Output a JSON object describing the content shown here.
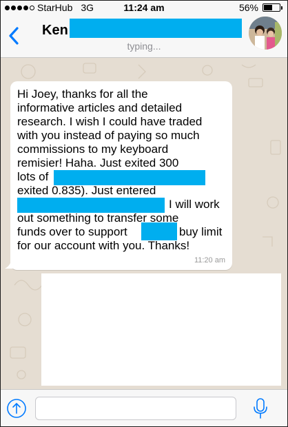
{
  "status_bar": {
    "carrier": "StarHub",
    "network": "3G",
    "time": "11:24 am",
    "battery": "56%",
    "battery_level": 0.56
  },
  "header": {
    "back_icon": "chevron-left-icon",
    "contact_name": "Ken",
    "status": "typing..."
  },
  "message": {
    "lines": [
      "Hi Joey, thanks for all the",
      "informative articles and detailed",
      "research.  I wish I could have traded",
      "with you instead of paying so much",
      "commissions to my keyboard",
      "remisier!  Haha.  Just exited 300",
      "lots of",
      "exited 0.835).   Just entered",
      "I will work",
      "out something to transfer some",
      "funds over to support",
      "buy limit",
      "for our account with you.  Thanks!"
    ],
    "time": "11:20 am"
  },
  "input_bar": {
    "upload_icon": "arrow-up-circle-icon",
    "placeholder": "",
    "mic_icon": "microphone-icon"
  },
  "colors": {
    "accent": "#007aff",
    "redaction": "#00aeef",
    "chat_background": "#e5ddd2"
  }
}
